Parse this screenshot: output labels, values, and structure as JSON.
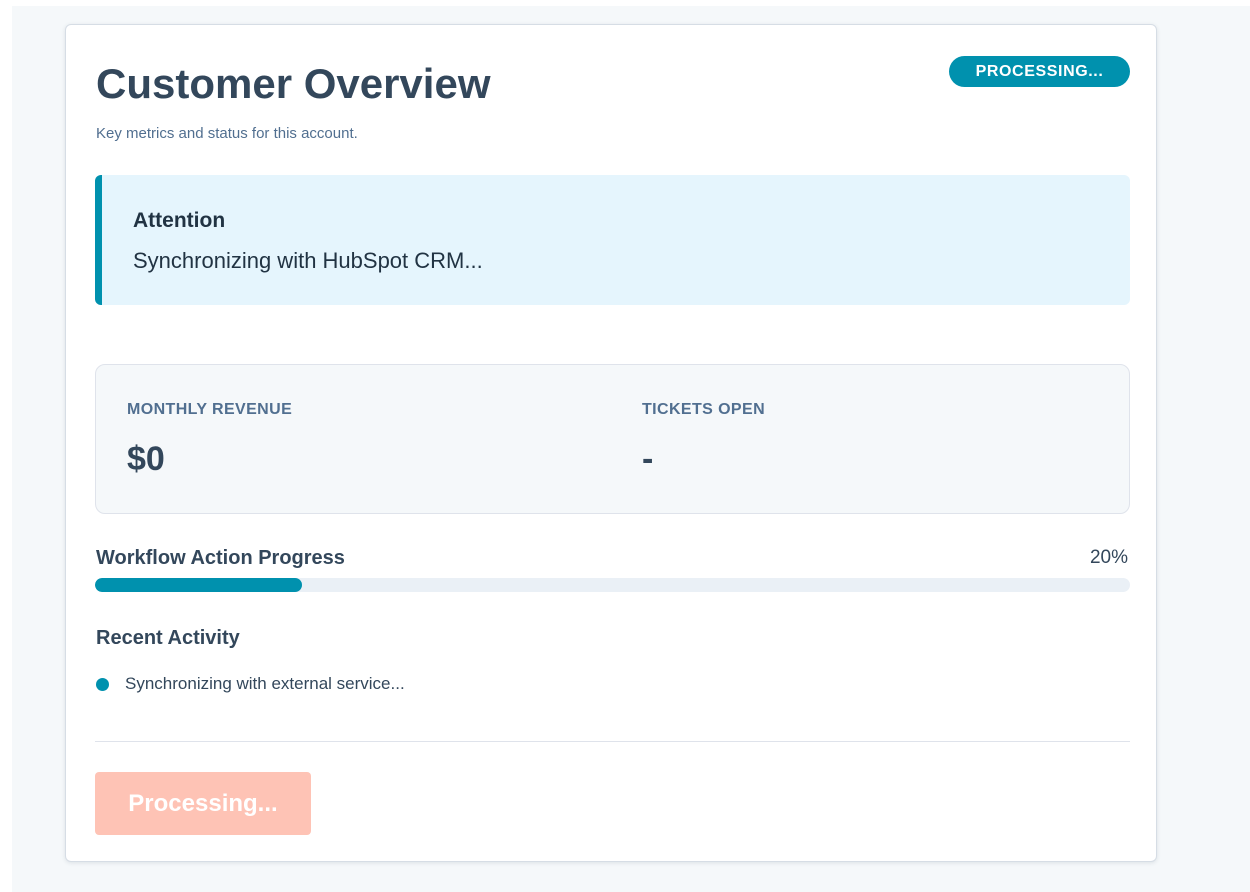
{
  "card": {
    "title": "Customer Overview",
    "subtitle": "Key metrics and status for this account.",
    "status_badge": "PROCESSING..."
  },
  "alert": {
    "title": "Attention",
    "message": "Synchronizing with HubSpot CRM..."
  },
  "metrics": [
    {
      "label": "MONTHLY REVENUE",
      "value": "$0"
    },
    {
      "label": "TICKETS OPEN",
      "value": "-"
    }
  ],
  "progress": {
    "label": "Workflow Action Progress",
    "value_text": "20%",
    "fraction": 0.2
  },
  "activity": {
    "heading": "Recent Activity",
    "items": [
      {
        "text": "Synchronizing with external service..."
      }
    ]
  },
  "action_button": {
    "label": "Processing...",
    "disabled": true
  },
  "colors": {
    "accent": "#0091ae",
    "heading": "#33475b",
    "alert_background": "#e5f5fd",
    "button_disabled": "#fec3b5"
  }
}
